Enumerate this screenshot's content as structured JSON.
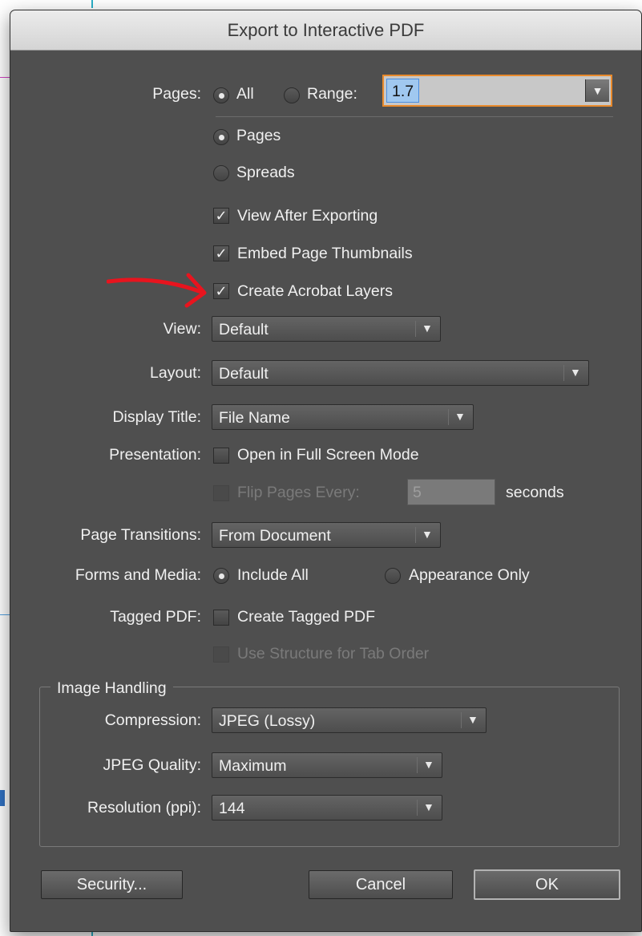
{
  "window": {
    "title": "Export to Interactive PDF"
  },
  "pages": {
    "label": "Pages:",
    "all_label": "All",
    "range_label": "Range:",
    "range_value": "1.7",
    "mode_pages": "Pages",
    "mode_spreads": "Spreads"
  },
  "options": {
    "view_after": "View After Exporting",
    "embed_thumbs": "Embed Page Thumbnails",
    "acrobat_layers": "Create Acrobat Layers"
  },
  "view": {
    "label": "View:",
    "value": "Default"
  },
  "layout": {
    "label": "Layout:",
    "value": "Default"
  },
  "display_title": {
    "label": "Display Title:",
    "value": "File Name"
  },
  "presentation": {
    "label": "Presentation:",
    "fullscreen": "Open in Full Screen Mode",
    "flip_label": "Flip Pages Every:",
    "flip_value": "5",
    "seconds": "seconds"
  },
  "transitions": {
    "label": "Page Transitions:",
    "value": "From Document"
  },
  "forms": {
    "label": "Forms and Media:",
    "include_all": "Include All",
    "appearance_only": "Appearance Only"
  },
  "tagged": {
    "label": "Tagged PDF:",
    "create": "Create Tagged PDF",
    "structure": "Use Structure for Tab Order"
  },
  "image": {
    "group_title": "Image Handling",
    "compression_label": "Compression:",
    "compression_value": "JPEG (Lossy)",
    "quality_label": "JPEG Quality:",
    "quality_value": "Maximum",
    "resolution_label": "Resolution (ppi):",
    "resolution_value": "144"
  },
  "buttons": {
    "security": "Security...",
    "cancel": "Cancel",
    "ok": "OK"
  },
  "icons": {
    "check": "✓",
    "arrow": "▼"
  },
  "colors": {
    "dialog_bg": "#4f4f4f",
    "focus_ring": "#e88a2c",
    "annotation": "#e8141e"
  }
}
